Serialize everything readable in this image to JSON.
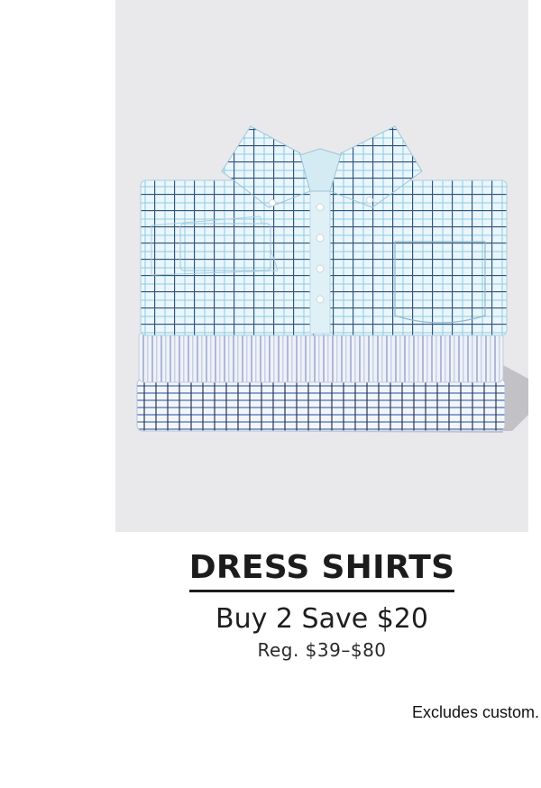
{
  "hero": {
    "image_description": "stack-of-dress-shirts-image",
    "background_color": "#e9e9eb"
  },
  "promo": {
    "title": "DRESS SHIRTS",
    "offer": "Buy 2 Save $20",
    "price": "Reg. $39–$80"
  },
  "footnote": "Excludes custom."
}
